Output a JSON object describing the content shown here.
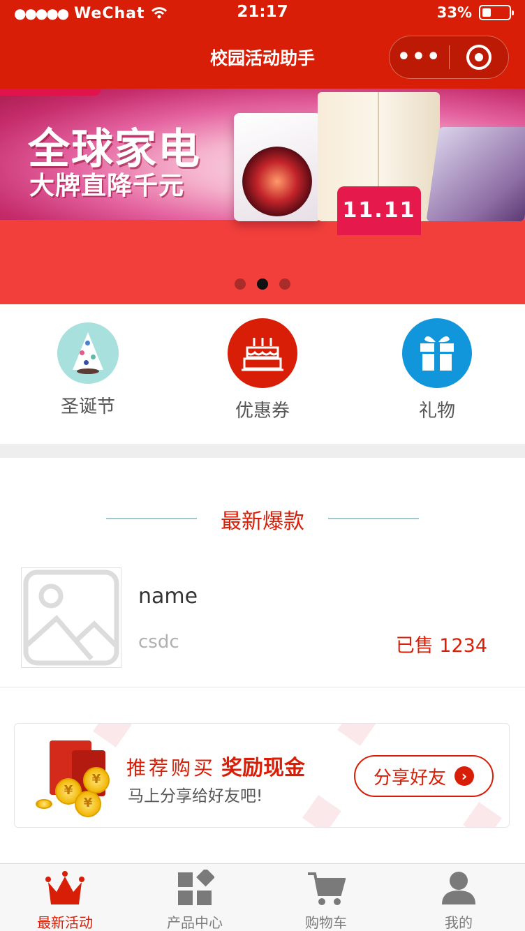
{
  "status_bar": {
    "carrier_dots": "●●●●●",
    "carrier": "WeChat",
    "time": "21:17",
    "battery": "33%"
  },
  "nav": {
    "title": "校园活动助手",
    "more_label": "•••"
  },
  "banner": {
    "headline": "全球家电",
    "subline": "大牌直降千元",
    "badge": "11.11",
    "slide_count": 3,
    "active_slide": 2
  },
  "categories": [
    {
      "label": "圣诞节",
      "icon": "christmas-tree-icon",
      "color": "#a8e0dd"
    },
    {
      "label": "优惠券",
      "icon": "birthday-cake-icon",
      "color": "#d81e06"
    },
    {
      "label": "礼物",
      "icon": "gift-box-icon",
      "color": "#1296db"
    }
  ],
  "section": {
    "title": "最新爆款"
  },
  "products": [
    {
      "name": "name",
      "desc": "csdc",
      "sold": "已售 1234",
      "image": "image-placeholder-icon"
    }
  ],
  "promo": {
    "title_a": "推荐购买",
    "title_b": "奖励现金",
    "subtitle": "马上分享给好友吧!",
    "button": "分享好友",
    "coin_symbol": "¥"
  },
  "tabbar": [
    {
      "label": "最新活动",
      "icon": "crown-icon",
      "active": true
    },
    {
      "label": "产品中心",
      "icon": "grid-icon",
      "active": false
    },
    {
      "label": "购物车",
      "icon": "cart-icon",
      "active": false
    },
    {
      "label": "我的",
      "icon": "user-icon",
      "active": false
    }
  ],
  "colors": {
    "brand": "#d81e06",
    "accent_blue": "#1296db",
    "mint": "#a8e0dd",
    "divider": "#9cc8cf"
  }
}
